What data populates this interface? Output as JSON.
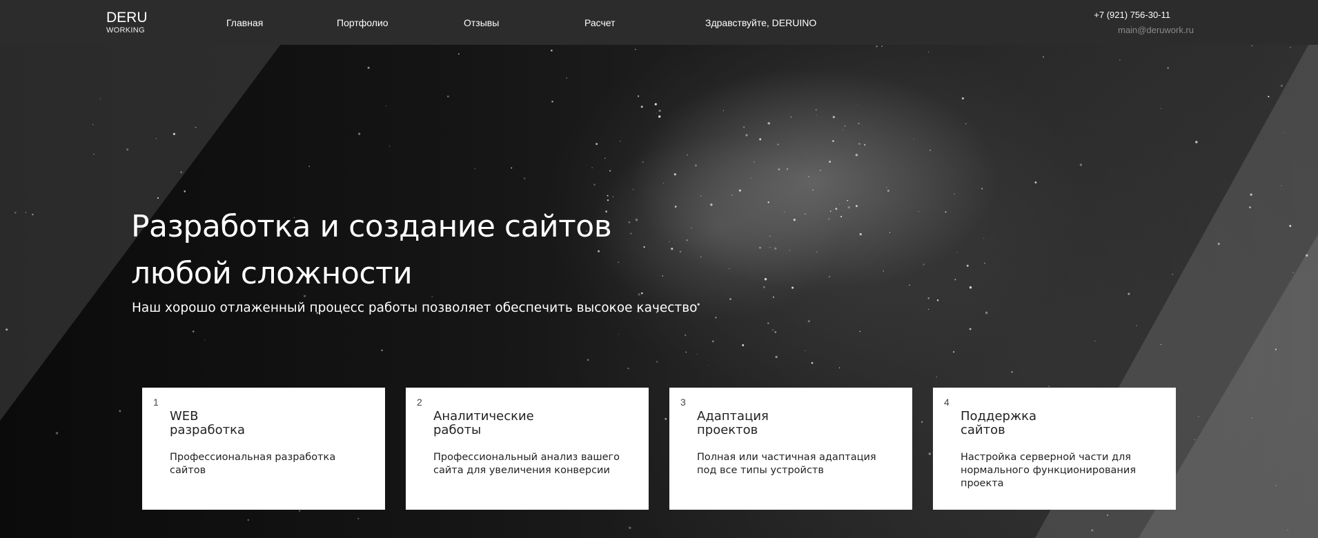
{
  "header": {
    "logo_main": "DERU",
    "logo_sub": "WORKING",
    "nav": [
      "Главная",
      "Портфолио",
      "Отзывы",
      "Расчет",
      "Здравствуйте, DERUINO"
    ],
    "phone": "+7 (921) 756-30-11",
    "email": "main@deruwork.ru"
  },
  "hero": {
    "title_line1": "Разработка и создание сайтов",
    "title_line2": "любой сложности",
    "subtitle": "Наш хорошо отлаженный процесс работы позволяет обеспечить высокое качество"
  },
  "cards": [
    {
      "num": "1",
      "title1": "WEB",
      "title2": "разработка",
      "text": "Профессиональная разработка сайтов"
    },
    {
      "num": "2",
      "title1": "Аналитические",
      "title2": "работы",
      "text": "Профессиональный анализ вашего сайта для увеличения конверсии"
    },
    {
      "num": "3",
      "title1": "Адаптация",
      "title2": "проектов",
      "text": "Полная или частичная адаптация под все типы устройств"
    },
    {
      "num": "4",
      "title1": "Поддержка",
      "title2": "сайтов",
      "text": "Настройка серверной части для нормального функционирования проекта"
    }
  ],
  "colors": {
    "header_bg": "#2c2c2c",
    "card_bg": "#ffffff",
    "email_text": "#8a8a8a"
  }
}
